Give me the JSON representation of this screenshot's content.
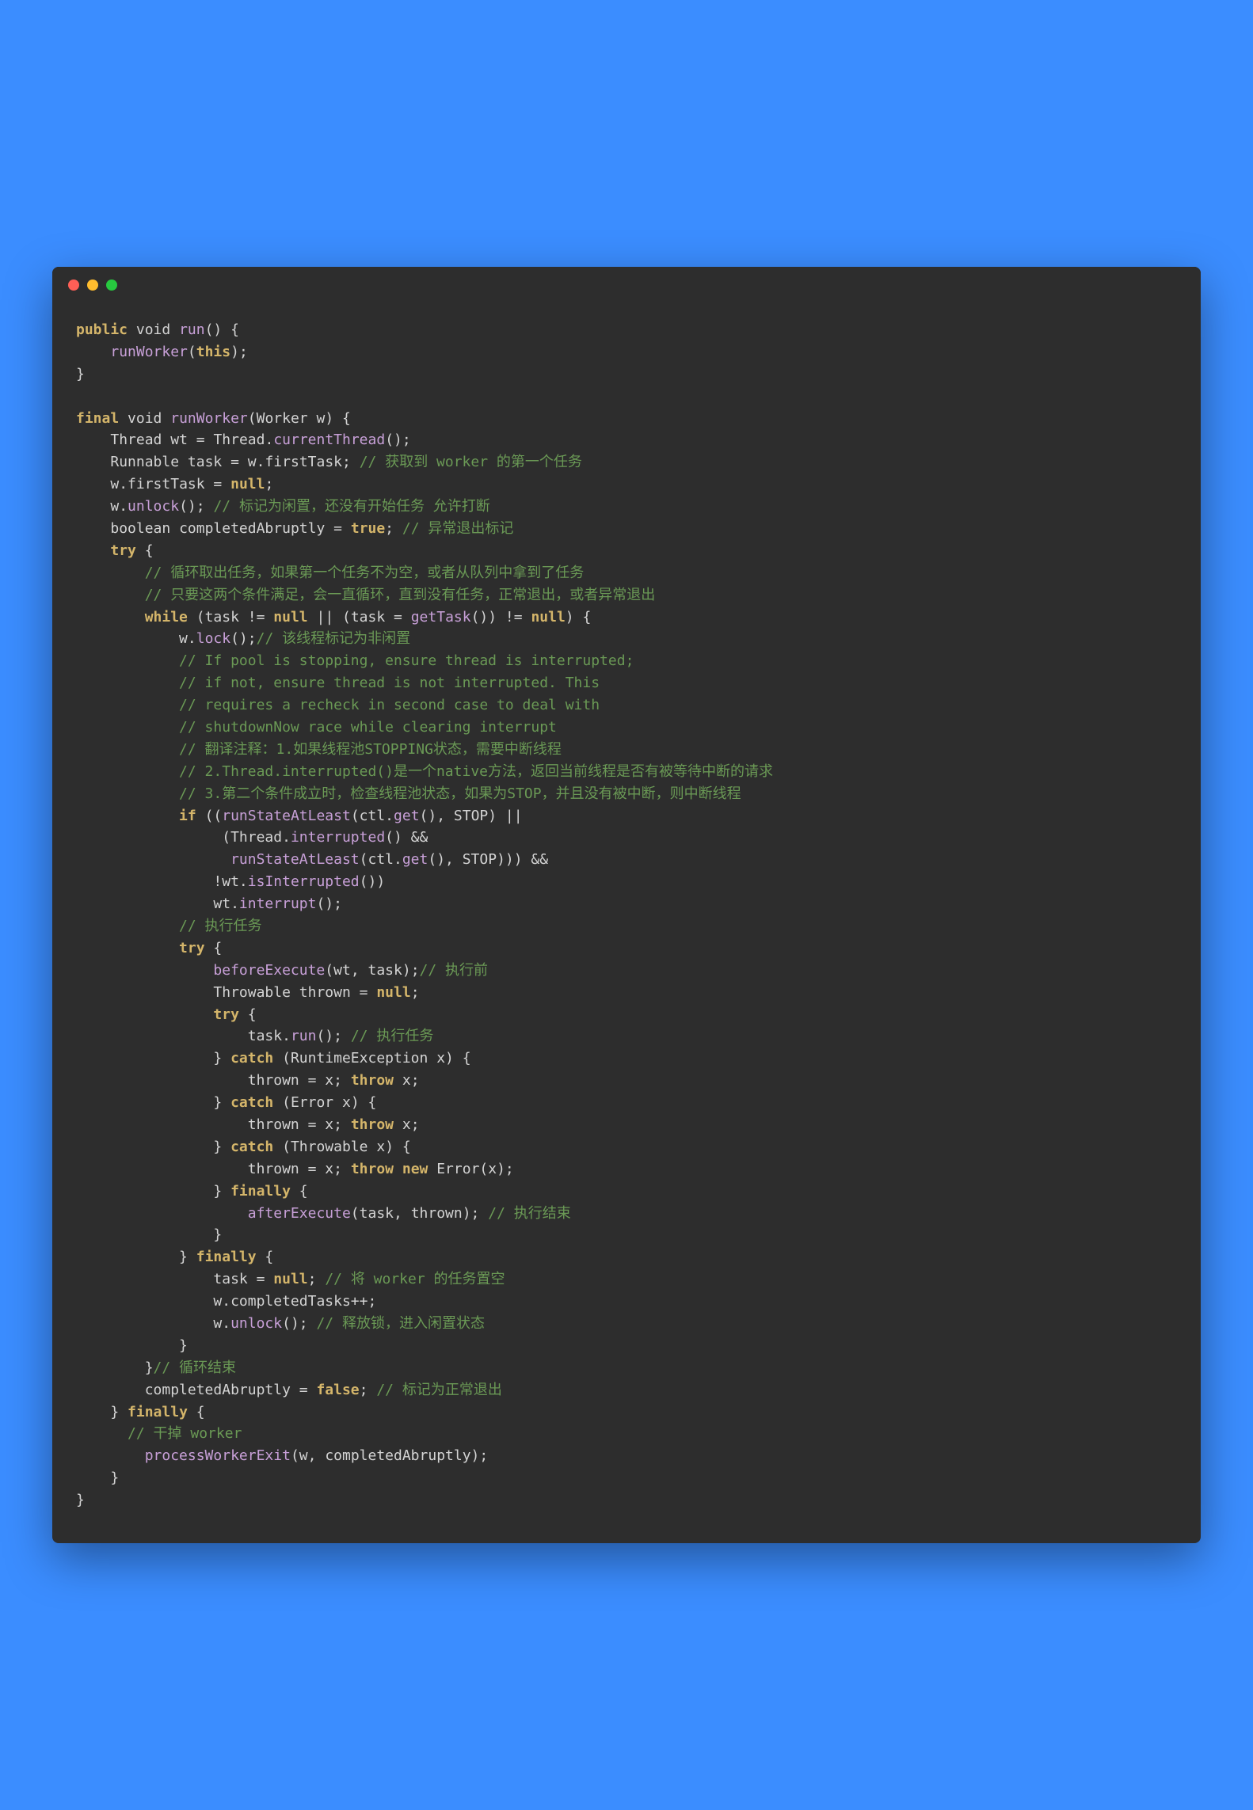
{
  "colors": {
    "background": "#3b8dff",
    "window_bg": "#2d2d2d",
    "keyword": "#d4b56a",
    "method": "#8cdcfe",
    "call": "#c8a0d8",
    "comment": "#6a9955",
    "text": "#d4d4d4",
    "dot_red": "#ff5f56",
    "dot_yellow": "#ffbd2e",
    "dot_green": "#27c93f"
  },
  "code": {
    "l1": {
      "kw_public": "public",
      "type_void": "void",
      "m_run": "run",
      "p": "() {"
    },
    "l2": {
      "call": "runWorker",
      "p_open": "(",
      "kw_this": "this",
      "p_close": ");"
    },
    "l3": {
      "p": "}"
    },
    "l5": {
      "kw_final": "final",
      "type_void": "void",
      "m_runWorker": "runWorker",
      "p_open": "(",
      "type_worker": "Worker",
      "param_w": "w",
      "p_close": ") {"
    },
    "l6": {
      "type_thread": "Thread",
      "v_wt": "wt",
      "eq": " = ",
      "call_thread": "Thread",
      "dot": ".",
      "call_ct": "currentThread",
      "p": "();"
    },
    "l7": {
      "type_runnable": "Runnable",
      "v_task": "task",
      "eq": " = ",
      "v_w": "w",
      "dot": ".",
      "f_firstTask": "firstTask",
      "semi": "; ",
      "c": "// 获取到 worker 的第一个任务"
    },
    "l8": {
      "v_w": "w",
      "dot": ".",
      "f_firstTask": "firstTask",
      "eq": " = ",
      "kw_null": "null",
      "semi": ";"
    },
    "l9": {
      "v_w": "w",
      "dot": ".",
      "call_unlock": "unlock",
      "p": "(); ",
      "c": "// 标记为闲置，还没有开始任务 允许打断"
    },
    "l10": {
      "type_bool": "boolean",
      "v_ca": "completedAbruptly",
      "eq": " = ",
      "kw_true": "true",
      "semi": "; ",
      "c": "// 异常退出标记"
    },
    "l11": {
      "kw_try": "try",
      "p": " {"
    },
    "l12": {
      "c": "// 循环取出任务，如果第一个任务不为空，或者从队列中拿到了任务"
    },
    "l13": {
      "c": "// 只要这两个条件满足，会一直循环，直到没有任务，正常退出，或者异常退出"
    },
    "l14": {
      "kw_while": "while",
      "p_open": " (",
      "v_task1": "task",
      "ne": " != ",
      "kw_null1": "null",
      "or": " || (",
      "v_task2": "task",
      "eq": " = ",
      "call_getTask": "getTask",
      "p_gt": "()) != ",
      "kw_null2": "null",
      "p_close": ") {"
    },
    "l15": {
      "v_w": "w",
      "dot": ".",
      "call_lock": "lock",
      "p": "();",
      "c": "// 该线程标记为非闲置"
    },
    "l16": {
      "c": "// If pool is stopping, ensure thread is interrupted;"
    },
    "l17": {
      "c": "// if not, ensure thread is not interrupted. This"
    },
    "l18": {
      "c": "// requires a recheck in second case to deal with"
    },
    "l19": {
      "c": "// shutdownNow race while clearing interrupt"
    },
    "l20": {
      "c": "// 翻译注释：1.如果线程池STOPPING状态，需要中断线程"
    },
    "l21": {
      "c": "// 2.Thread.interrupted()是一个native方法，返回当前线程是否有被等待中断的请求"
    },
    "l22": {
      "c": "// 3.第二个条件成立时，检查线程池状态，如果为STOP，并且没有被中断，则中断线程"
    },
    "l23": {
      "kw_if": "if",
      "p_open": " ((",
      "call_rsal": "runStateAtLeast",
      "p_o2": "(",
      "v_ctl": "ctl",
      "dot": ".",
      "call_get": "get",
      "p_g": "(), ",
      "v_stop": "STOP",
      "p_close": ") ||"
    },
    "l24": {
      "p_open": "(",
      "call_thread": "Thread",
      "dot": ".",
      "call_int": "interrupted",
      "p_close": "() &&"
    },
    "l25": {
      "call_rsal": "runStateAtLeast",
      "p_o": "(",
      "v_ctl": "ctl",
      "dot": ".",
      "call_get": "get",
      "p_g": "(), ",
      "v_stop": "STOP",
      "p_close": "))) &&"
    },
    "l26": {
      "neg": "!",
      "v_wt": "wt",
      "dot": ".",
      "call_isint": "isInterrupted",
      "p": "())"
    },
    "l27": {
      "v_wt": "wt",
      "dot": ".",
      "call_int": "interrupt",
      "p": "();"
    },
    "l28": {
      "c": "// 执行任务"
    },
    "l29": {
      "kw_try": "try",
      "p": " {"
    },
    "l30": {
      "call_be": "beforeExecute",
      "p_o": "(",
      "v_wt": "wt",
      "comma": ", ",
      "v_task": "task",
      "p_c": ");",
      "c": "// 执行前"
    },
    "l31": {
      "type_throwable": "Throwable",
      "v_thrown": "thrown",
      "eq": " = ",
      "kw_null": "null",
      "semi": ";"
    },
    "l32": {
      "kw_try": "try",
      "p": " {"
    },
    "l33": {
      "v_task": "task",
      "dot": ".",
      "call_run": "run",
      "p": "(); ",
      "c": "// 执行任务"
    },
    "l34": {
      "p_close": "} ",
      "kw_catch": "catch",
      "p_o": " (",
      "type_re": "RuntimeException",
      "v_x": "x",
      "p_c": ") {"
    },
    "l35": {
      "v_thrown": "thrown",
      "eq": " = ",
      "v_x": "x",
      "semi": "; ",
      "kw_throw": "throw",
      "sp": " ",
      "v_x2": "x",
      "semi2": ";"
    },
    "l36": {
      "p_close": "} ",
      "kw_catch": "catch",
      "p_o": " (",
      "type_err": "Error",
      "v_x": "x",
      "p_c": ") {"
    },
    "l37": {
      "v_thrown": "thrown",
      "eq": " = ",
      "v_x": "x",
      "semi": "; ",
      "kw_throw": "throw",
      "sp": " ",
      "v_x2": "x",
      "semi2": ";"
    },
    "l38": {
      "p_close": "} ",
      "kw_catch": "catch",
      "p_o": " (",
      "type_throwable": "Throwable",
      "v_x": "x",
      "p_c": ") {"
    },
    "l39": {
      "v_thrown": "thrown",
      "eq": " = ",
      "v_x": "x",
      "semi": "; ",
      "kw_throw": "throw",
      "sp": " ",
      "kw_new": "new",
      "sp2": " ",
      "type_err": "Error",
      "p_o": "(",
      "v_x2": "x",
      "p_c": ");"
    },
    "l40": {
      "p_close": "} ",
      "kw_finally": "finally",
      "p": " {"
    },
    "l41": {
      "call_ae": "afterExecute",
      "p_o": "(",
      "v_task": "task",
      "comma": ", ",
      "v_thrown": "thrown",
      "p_c": "); ",
      "c": "// 执行结束"
    },
    "l42": {
      "p": "}"
    },
    "l43": {
      "p_close": "} ",
      "kw_finally": "finally",
      "p": " {"
    },
    "l44": {
      "v_task": "task",
      "eq": " = ",
      "kw_null": "null",
      "semi": "; ",
      "c": "// 将 worker 的任务置空"
    },
    "l45": {
      "v_w": "w",
      "dot": ".",
      "f_ct": "completedTasks",
      "op": "++;"
    },
    "l46": {
      "v_w": "w",
      "dot": ".",
      "call_unlock": "unlock",
      "p": "(); ",
      "c": "// 释放锁，进入闲置状态"
    },
    "l47": {
      "p": "}"
    },
    "l48": {
      "p": "}",
      "c": "// 循环结束"
    },
    "l49": {
      "v_ca": "completedAbruptly",
      "eq": " = ",
      "kw_false": "false",
      "semi": "; ",
      "c": "// 标记为正常退出"
    },
    "l50": {
      "p_close": "} ",
      "kw_finally": "finally",
      "p": " {"
    },
    "l51": {
      "c": "// 干掉 worker"
    },
    "l52": {
      "call_pwe": "processWorkerExit",
      "p_o": "(",
      "v_w": "w",
      "comma": ", ",
      "v_ca": "completedAbruptly",
      "p_c": ");"
    },
    "l53": {
      "p": "}"
    },
    "l54": {
      "p": "}"
    }
  }
}
